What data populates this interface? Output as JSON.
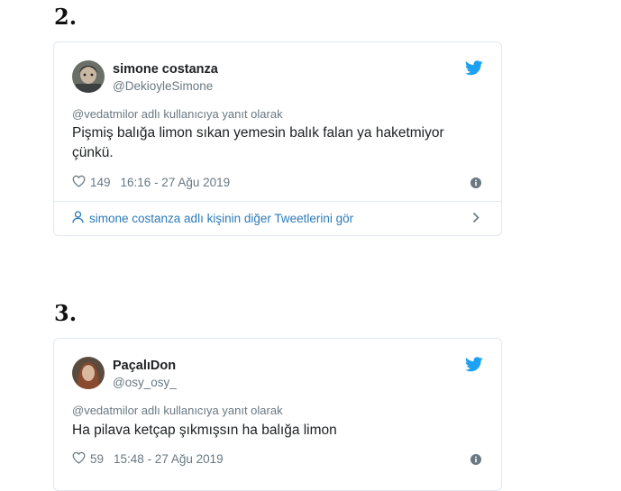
{
  "items": [
    {
      "number": "2.",
      "tweet": {
        "display_name": "simone costanza",
        "handle": "@DekioyleSimone",
        "reply_to": "@vedatmilor adlı kullanıcıya yanıt olarak",
        "text": "Pişmiş balığa limon sıkan yemesin balık falan ya haketmiyor çünkü.",
        "likes": "149",
        "timestamp": "16:16 - 27 Ağu 2019",
        "more_link": "simone costanza adlı kişinin diğer Tweetlerini gör"
      }
    },
    {
      "number": "3.",
      "tweet": {
        "display_name": "PaçalıDon",
        "handle": "@osy_osy_",
        "reply_to": "@vedatmilor adlı kullanıcıya yanıt olarak",
        "text": "Ha pilava ketçap şıkmışsın ha balığa limon",
        "likes": "59",
        "timestamp": "15:48 - 27 Ağu 2019"
      }
    }
  ],
  "colors": {
    "twitter_blue": "#1da1f2",
    "link_blue": "#2b7bb9",
    "muted_gray": "#697882",
    "border": "#e1e8ed"
  },
  "icons": [
    "twitter-bird-icon",
    "heart-icon",
    "info-icon",
    "person-icon",
    "chevron-right-icon"
  ]
}
